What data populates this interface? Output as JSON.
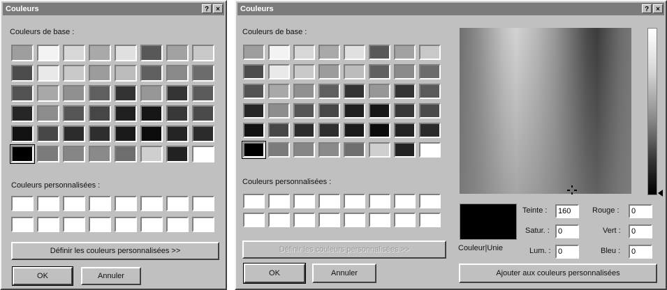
{
  "dialog1": {
    "title": "Couleurs",
    "basic_colors_label": "Couleurs de base :",
    "custom_colors_label": "Couleurs personnalisées :",
    "define_button": "Définir les couleurs personnalisées >>",
    "ok_button": "OK",
    "cancel_button": "Annuler"
  },
  "dialog2": {
    "title": "Couleurs",
    "basic_colors_label": "Couleurs de base :",
    "custom_colors_label": "Couleurs personnalisées :",
    "define_button": "Définir les couleurs personnalisées >>",
    "ok_button": "OK",
    "cancel_button": "Annuler",
    "preview_label": "Couleur|Unie",
    "add_button": "Ajouter aux couleurs personnalisées",
    "fields": {
      "teinte_label": "Teinte :",
      "teinte_value": "160",
      "satur_label": "Satur. :",
      "satur_value": "0",
      "lum_label": "Lum. :",
      "lum_value": "0",
      "rouge_label": "Rouge :",
      "rouge_value": "0",
      "vert_label": "Vert :",
      "vert_value": "0",
      "bleu_label": "Bleu :",
      "bleu_value": "0"
    }
  },
  "titlebar_buttons": {
    "help": "?",
    "close": "×"
  },
  "basic_colors": [
    [
      "#9e9e9e",
      "#f3f3f3",
      "#d7d7d7",
      "#a9a9a9",
      "#e0e0e0",
      "#585858",
      "#a2a2a2",
      "#c8c8c8"
    ],
    [
      "#4c4c4c",
      "#e9e9e9",
      "#c9c9c9",
      "#9c9c9c",
      "#bcbcbc",
      "#606060",
      "#8a8a8a",
      "#6c6c6c"
    ],
    [
      "#535353",
      "#a8a8a8",
      "#909090",
      "#5f5f5f",
      "#333333",
      "#979797",
      "#343434",
      "#5a5a5a"
    ],
    [
      "#262626",
      "#8d8d8d",
      "#555555",
      "#464646",
      "#202020",
      "#161616",
      "#383838",
      "#4a4a4a"
    ],
    [
      "#121212",
      "#474747",
      "#2c2c2c",
      "#2e2e2e",
      "#1a1a1a",
      "#0c0c0c",
      "#242424",
      "#2b2b2b"
    ],
    [
      "#000000",
      "#7b7b7b",
      "#868686",
      "#8a8a8a",
      "#6e6e6e",
      "#cfcfcf",
      "#222222",
      "#ffffff"
    ]
  ],
  "custom_colors": [
    [
      "#ffffff",
      "#ffffff",
      "#ffffff",
      "#ffffff",
      "#ffffff",
      "#ffffff",
      "#ffffff",
      "#ffffff"
    ],
    [
      "#ffffff",
      "#ffffff",
      "#ffffff",
      "#ffffff",
      "#ffffff",
      "#ffffff",
      "#ffffff",
      "#ffffff"
    ]
  ],
  "preview_color": "#000000",
  "colors": {
    "dialog_bg": "#c0c0c0",
    "titlebar_bg": "#7b7b7b"
  }
}
